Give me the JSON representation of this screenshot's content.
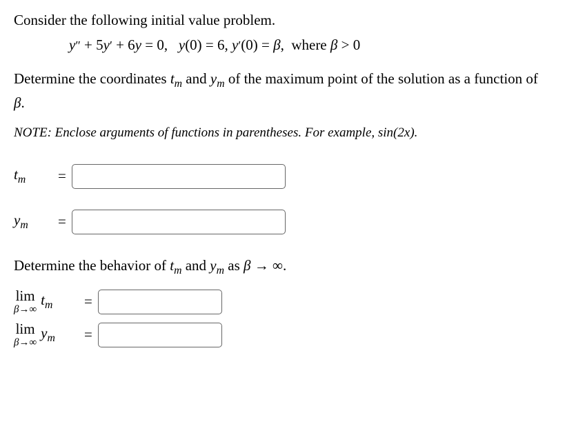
{
  "problem": {
    "intro": "Consider the following initial value problem.",
    "equation_html": "y″ + 5y′ + 6y = 0,   y(0) = 6, y′(0) = β,  where β > 0",
    "question_html": "Determine the coordinates tₘ and yₘ of the maximum point of the solution as a function of β.",
    "note_html": "NOTE: Enclose arguments of functions in parentheses. For example, sin(2x).",
    "behavior_html": "Determine the behavior of tₘ and yₘ as β → ∞."
  },
  "inputs": {
    "tm_value": "",
    "ym_value": "",
    "lim_tm_value": "",
    "lim_ym_value": ""
  }
}
